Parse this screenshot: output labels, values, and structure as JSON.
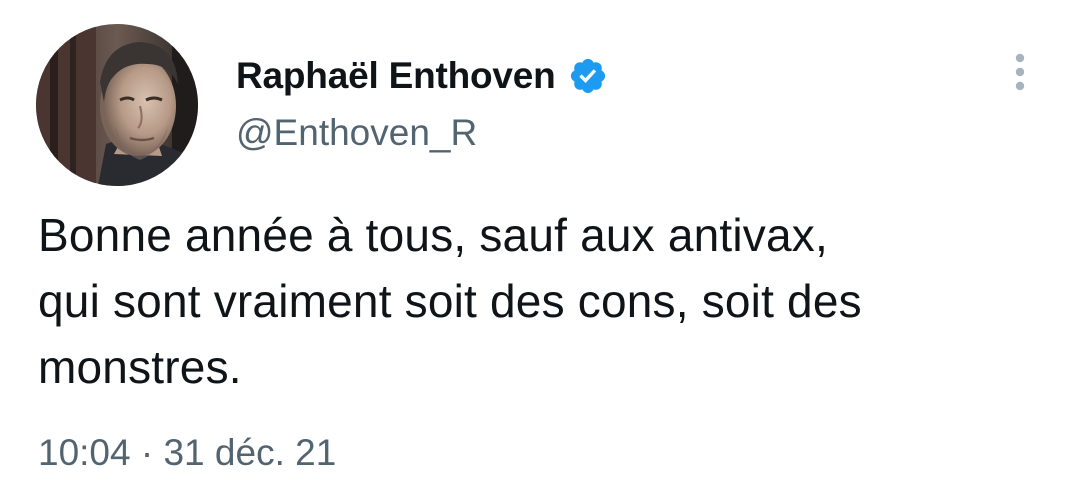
{
  "author": {
    "display_name": "Raphaël Enthoven",
    "handle": "@Enthoven_R",
    "verified": true
  },
  "tweet": {
    "text_lines": [
      "Bonne année à tous, sauf aux antivax,",
      "qui sont vraiment soit des cons, soit des",
      "monstres."
    ],
    "time": "10:04",
    "separator": "·",
    "date": "31 déc. 21"
  },
  "icons": {
    "verified": "verified-badge-icon",
    "more": "more-vertical-icon"
  },
  "colors": {
    "text": "#0f1419",
    "secondary": "#536471",
    "verified_blue": "#1d9bf0",
    "more_icon": "#a8b4bd"
  }
}
